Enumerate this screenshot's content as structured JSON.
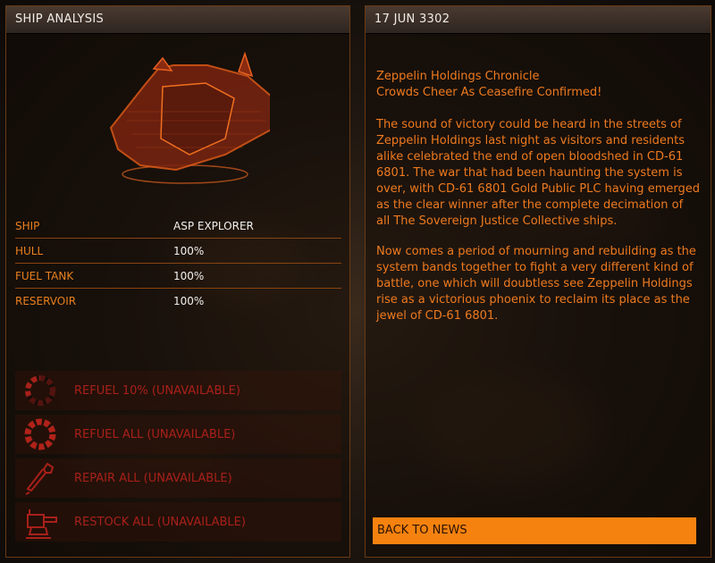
{
  "left_panel": {
    "title": "SHIP ANALYSIS",
    "stats": [
      {
        "label": "SHIP",
        "value": "ASP EXPLORER"
      },
      {
        "label": "HULL",
        "value": "100%"
      },
      {
        "label": "FUEL TANK",
        "value": "100%"
      },
      {
        "label": "RESERVOIR",
        "value": "100%"
      }
    ],
    "actions": [
      {
        "label": "REFUEL 10% (UNAVAILABLE)",
        "icon": "partial-fuel-ring-icon"
      },
      {
        "label": "REFUEL ALL (UNAVAILABLE)",
        "icon": "full-fuel-ring-icon"
      },
      {
        "label": "REPAIR ALL (UNAVAILABLE)",
        "icon": "wrench-icon"
      },
      {
        "label": "RESTOCK ALL (UNAVAILABLE)",
        "icon": "turret-icon"
      }
    ]
  },
  "right_panel": {
    "date": "17 JUN 3302",
    "source": "Zeppelin Holdings Chronicle",
    "headline": "Crowds Cheer As Ceasefire Confirmed!",
    "paragraphs": [
      "The sound of victory could be heard in the streets of Zeppelin Holdings last night as visitors and residents alike celebrated the end of open bloodshed in CD-61 6801. The war that had been haunting the system is over, with CD-61 6801 Gold Public PLC having emerged as the clear winner after the complete decimation of all The Sovereign Justice Collective ships.",
      "Now comes a period of mourning and rebuilding as the system bands together to fight a very different kind of battle, one which will doubtless see Zeppelin Holdings rise as a victorious phoenix to reclaim its place as the jewel of CD-61 6801."
    ],
    "back_button": "BACK TO NEWS"
  },
  "colors": {
    "accent_orange": "#ee7a1f",
    "unavailable_red": "#a8201a",
    "button_orange": "#f5820f",
    "divider": "#8a4410"
  }
}
